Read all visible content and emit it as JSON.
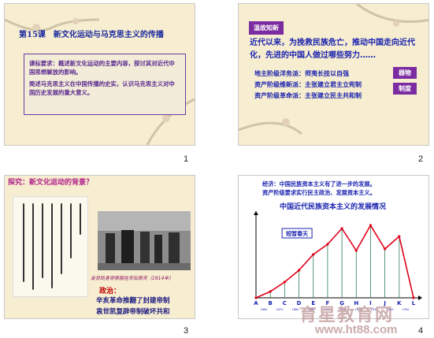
{
  "slides": [
    {
      "number": "1",
      "title": "第15课　新文化运动与马克思主义的传播",
      "box_lines": [
        "课标要求：概述新文化运动的主要内容，探讨其对近代中国思想解放的影响。",
        "简述马克思主义在中国传播的史实，认识马克思主义对中国历史发展的重大意义。"
      ]
    },
    {
      "number": "2",
      "tag": "温故知新",
      "main_text": "近代以来，为挽救民族危亡，推动中国走向近代化，先进的中国人做过哪些努力……",
      "lines": [
        "地主阶级洋务派：师夷长技以自强",
        "资产阶级维新派：主张建立君主立宪制",
        "资产阶级革命派：主张建立民主共和制"
      ],
      "side_tags": [
        "器物",
        "制度"
      ]
    },
    {
      "number": "3",
      "title": "探究：新文化运动的背景？",
      "caption": "袁世凯身穿祭服在天坛祭天（1914年）",
      "politics_label": "政治：",
      "text_lines": [
        "辛亥革命推翻了封建帝制",
        "袁世凯复辟帝制破坏共和"
      ]
    },
    {
      "number": "4",
      "line1": "经济：中国民族资本主义有了进一步的发展。",
      "line2": "资产阶级要求实行民主政治、发展资本主义。",
      "chart_title": "中国近代民族资本主义的发展情况",
      "annotation": "短暂春天"
    }
  ],
  "chart_data": {
    "type": "line",
    "title": "中国近代民族资本主义的发展情况",
    "x": [
      "A",
      "B",
      "C",
      "D",
      "E",
      "F",
      "G",
      "H",
      "I",
      "J",
      "K",
      "L"
    ],
    "x_years": [
      "1860",
      "1870",
      "1880",
      "1890",
      "1900",
      "1910",
      "1920",
      "1930",
      "1940",
      "1950"
    ],
    "values": [
      0,
      8,
      20,
      35,
      55,
      68,
      88,
      60,
      92,
      62,
      78,
      0
    ],
    "ylim": [
      0,
      100
    ],
    "annotation": "短暂春天"
  },
  "watermark": {
    "main": "育星教育网",
    "url": "www.ht88.com"
  },
  "colors": {
    "slide_bg": "#f7edd0",
    "title_blue": "#1b24b0",
    "purple": "#7b2ca0",
    "line_red": "#e0001a",
    "magenta": "#b0228a"
  }
}
